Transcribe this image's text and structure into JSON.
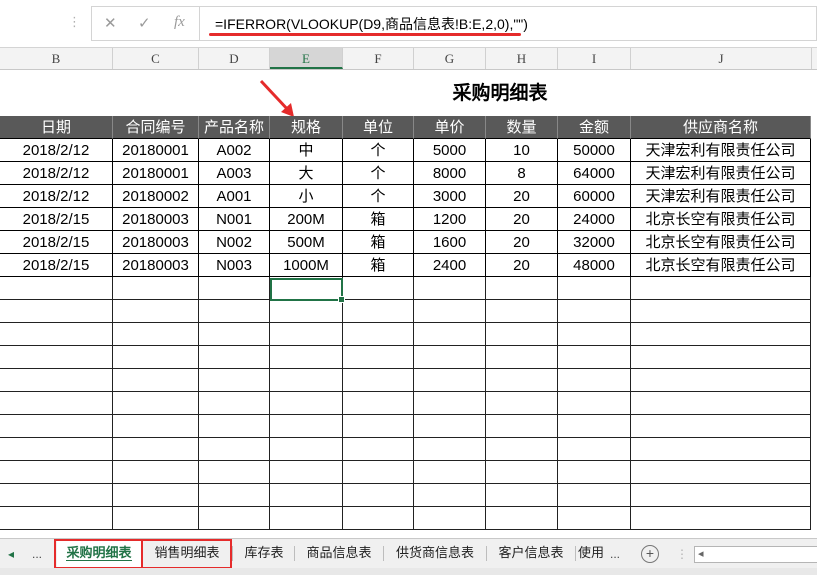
{
  "formula_bar": {
    "cancel_icon": "x-icon",
    "enter_icon": "check-icon",
    "fx_label": "fx",
    "formula": "=IFERROR(VLOOKUP(D9,商品信息表!B:E,2,0),\"\")"
  },
  "column_headers": [
    "B",
    "C",
    "D",
    "E",
    "F",
    "G",
    "H",
    "I",
    "J"
  ],
  "sheet_title": "采购明细表",
  "table": {
    "headers": [
      "日期",
      "合同编号",
      "产品名称",
      "规格",
      "单位",
      "单价",
      "数量",
      "金额",
      "供应商名称"
    ],
    "rows": [
      [
        "2018/2/12",
        "20180001",
        "A002",
        "中",
        "个",
        "5000",
        "10",
        "50000",
        "天津宏利有限责任公司"
      ],
      [
        "2018/2/12",
        "20180001",
        "A003",
        "大",
        "个",
        "8000",
        "8",
        "64000",
        "天津宏利有限责任公司"
      ],
      [
        "2018/2/12",
        "20180002",
        "A001",
        "小",
        "个",
        "3000",
        "20",
        "60000",
        "天津宏利有限责任公司"
      ],
      [
        "2018/2/15",
        "20180003",
        "N001",
        "200M",
        "箱",
        "1200",
        "20",
        "24000",
        "北京长空有限责任公司"
      ],
      [
        "2018/2/15",
        "20180003",
        "N002",
        "500M",
        "箱",
        "1600",
        "20",
        "32000",
        "北京长空有限责任公司"
      ],
      [
        "2018/2/15",
        "20180003",
        "N003",
        "1000M",
        "箱",
        "2400",
        "20",
        "48000",
        "北京长空有限责任公司"
      ]
    ]
  },
  "sheet_tabs": {
    "nav_prev": "◂",
    "nav_more": "...",
    "tabs": [
      "采购明细表",
      "销售明细表",
      "库存表",
      "商品信息表",
      "供货商信息表",
      "客户信息表",
      "使用"
    ],
    "more_after": "...",
    "add_icon": "plus-circle-icon",
    "add_label": "+"
  }
}
